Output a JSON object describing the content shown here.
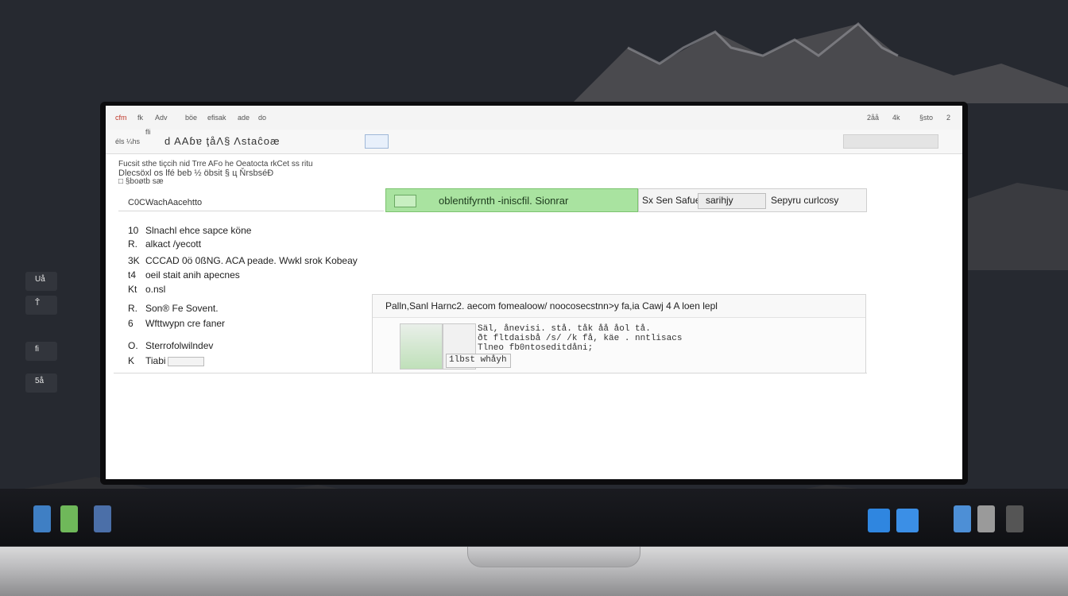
{
  "window": {
    "titlebar_left": [
      "cfm",
      "fk",
      "Adv",
      "böe",
      "efisak",
      "ade",
      "do"
    ],
    "titlebar_right": [
      "2åå",
      "4k",
      "§sto",
      "2"
    ],
    "ribbon_left_small": "éls   ¼hs",
    "ribbon_left_small2": "fli",
    "ribbon_tools": "d  AAɓɐ  ţåΛ§  Λstaĉoæ",
    "header_line1": "Fucsit sthe tiçcih nid Trre AFo he Oeatocta rkCet ss ritu",
    "header_line2": "Dlecsöxl os lfé beb ½ öbsit § ц ŇrsbséĐ",
    "header_line3": "□ §boøtb sæ",
    "section_title": "C0CWachAacehtto",
    "list": [
      {
        "key": "10",
        "text": "Slnachl ehce sapce köne"
      },
      {
        "key": "R.",
        "text": "alkact /yecott"
      },
      {
        "key": "3K",
        "text": "CCCAD 0ö 0ßNG. ACA peade. Wwkl srok Kobeay"
      },
      {
        "key": "t4",
        "text": "oeil stait anih apecnes"
      },
      {
        "key": "Kt",
        "text": "o.nsl"
      },
      {
        "key": "R.",
        "text": "Son® Fe Sovent."
      },
      {
        "key": "6",
        "text": "Wfttwypn cre faner"
      },
      {
        "key": "O.",
        "text": "Sterrofolwilndev"
      },
      {
        "key": "K",
        "text": "Tiabi"
      }
    ],
    "green_bar_text": "oblentifyrnth  -iniscfil. Sionrar",
    "toolbar_right": {
      "left_text": "Sx Sen Safue, f",
      "button_text": "sarihjy",
      "right_text": "Sepyru curlcosy"
    },
    "panel": {
      "header": "Palln,Sanl  Harnc2. aecom fomealoow/  noocosecstnn>y fa,ia Cawj 4  A loen lepl",
      "line1": "Säl, ånevisi. stå. tåk  åå  åol tå.",
      "line2": "ðt fltdaisbå /s/ /k  få, käe  .  nntlisacs",
      "line3": "Tlneo fb0ntoseditdåni;",
      "box_text": "1lbst whåyh"
    }
  },
  "desktop_icons": [
    "Uå",
    "T̂",
    "fi",
    "5å"
  ],
  "colors": {
    "accent_green": "#a9e3a0",
    "window_bg": "#ffffff",
    "desktop_bg": "#23262e"
  }
}
